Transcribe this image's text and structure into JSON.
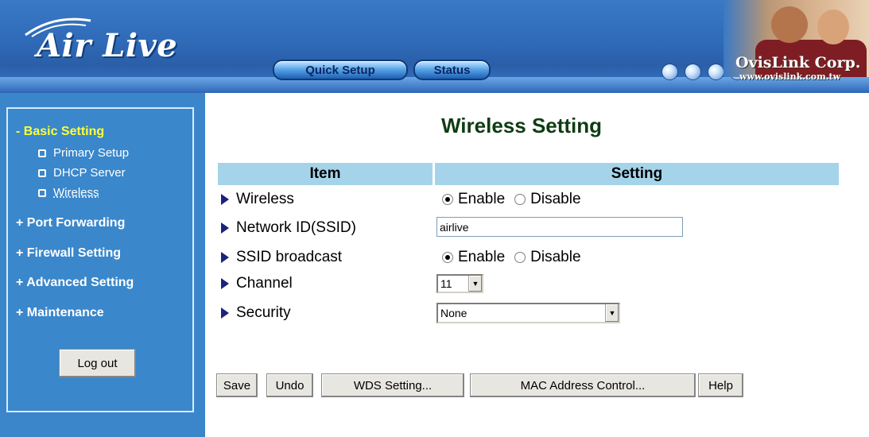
{
  "header": {
    "logo_text": "Air Live",
    "nav": {
      "quick_setup_label": "Quick Setup",
      "status_label": "Status"
    },
    "brand_name": "OvisLink Corp.",
    "brand_url": "www.ovislink.com.tw"
  },
  "sidebar": {
    "sections": [
      {
        "label": "- Basic Setting"
      },
      {
        "label": "+ Port Forwarding"
      },
      {
        "label": "+ Firewall Setting"
      },
      {
        "label": "+ Advanced Setting"
      },
      {
        "label": "+ Maintenance"
      }
    ],
    "subitems": [
      {
        "label": "Primary Setup"
      },
      {
        "label": "DHCP Server"
      },
      {
        "label": "Wireless"
      }
    ],
    "logout_label": "Log out"
  },
  "main": {
    "title": "Wireless Setting",
    "table_headers": {
      "item": "Item",
      "setting": "Setting"
    },
    "rows": {
      "wireless": {
        "label": "Wireless",
        "enable": "Enable",
        "disable": "Disable",
        "selected": "Enable"
      },
      "ssid": {
        "label": "Network ID(SSID)",
        "value": "airlive"
      },
      "ssid_broadcast": {
        "label": "SSID broadcast",
        "enable": "Enable",
        "disable": "Disable",
        "selected": "Enable"
      },
      "channel": {
        "label": "Channel",
        "value": "11"
      },
      "security": {
        "label": "Security",
        "value": "None"
      }
    },
    "buttons": {
      "save": "Save",
      "undo": "Undo",
      "wds": "WDS Setting...",
      "mac": "MAC Address Control...",
      "help": "Help"
    }
  },
  "colors": {
    "header_blue": "#2f6ab8",
    "sidebar_blue": "#3b86ca",
    "active_section": "#ffff33",
    "table_header": "#a5d4ea",
    "title_green": "#0f3c12"
  }
}
